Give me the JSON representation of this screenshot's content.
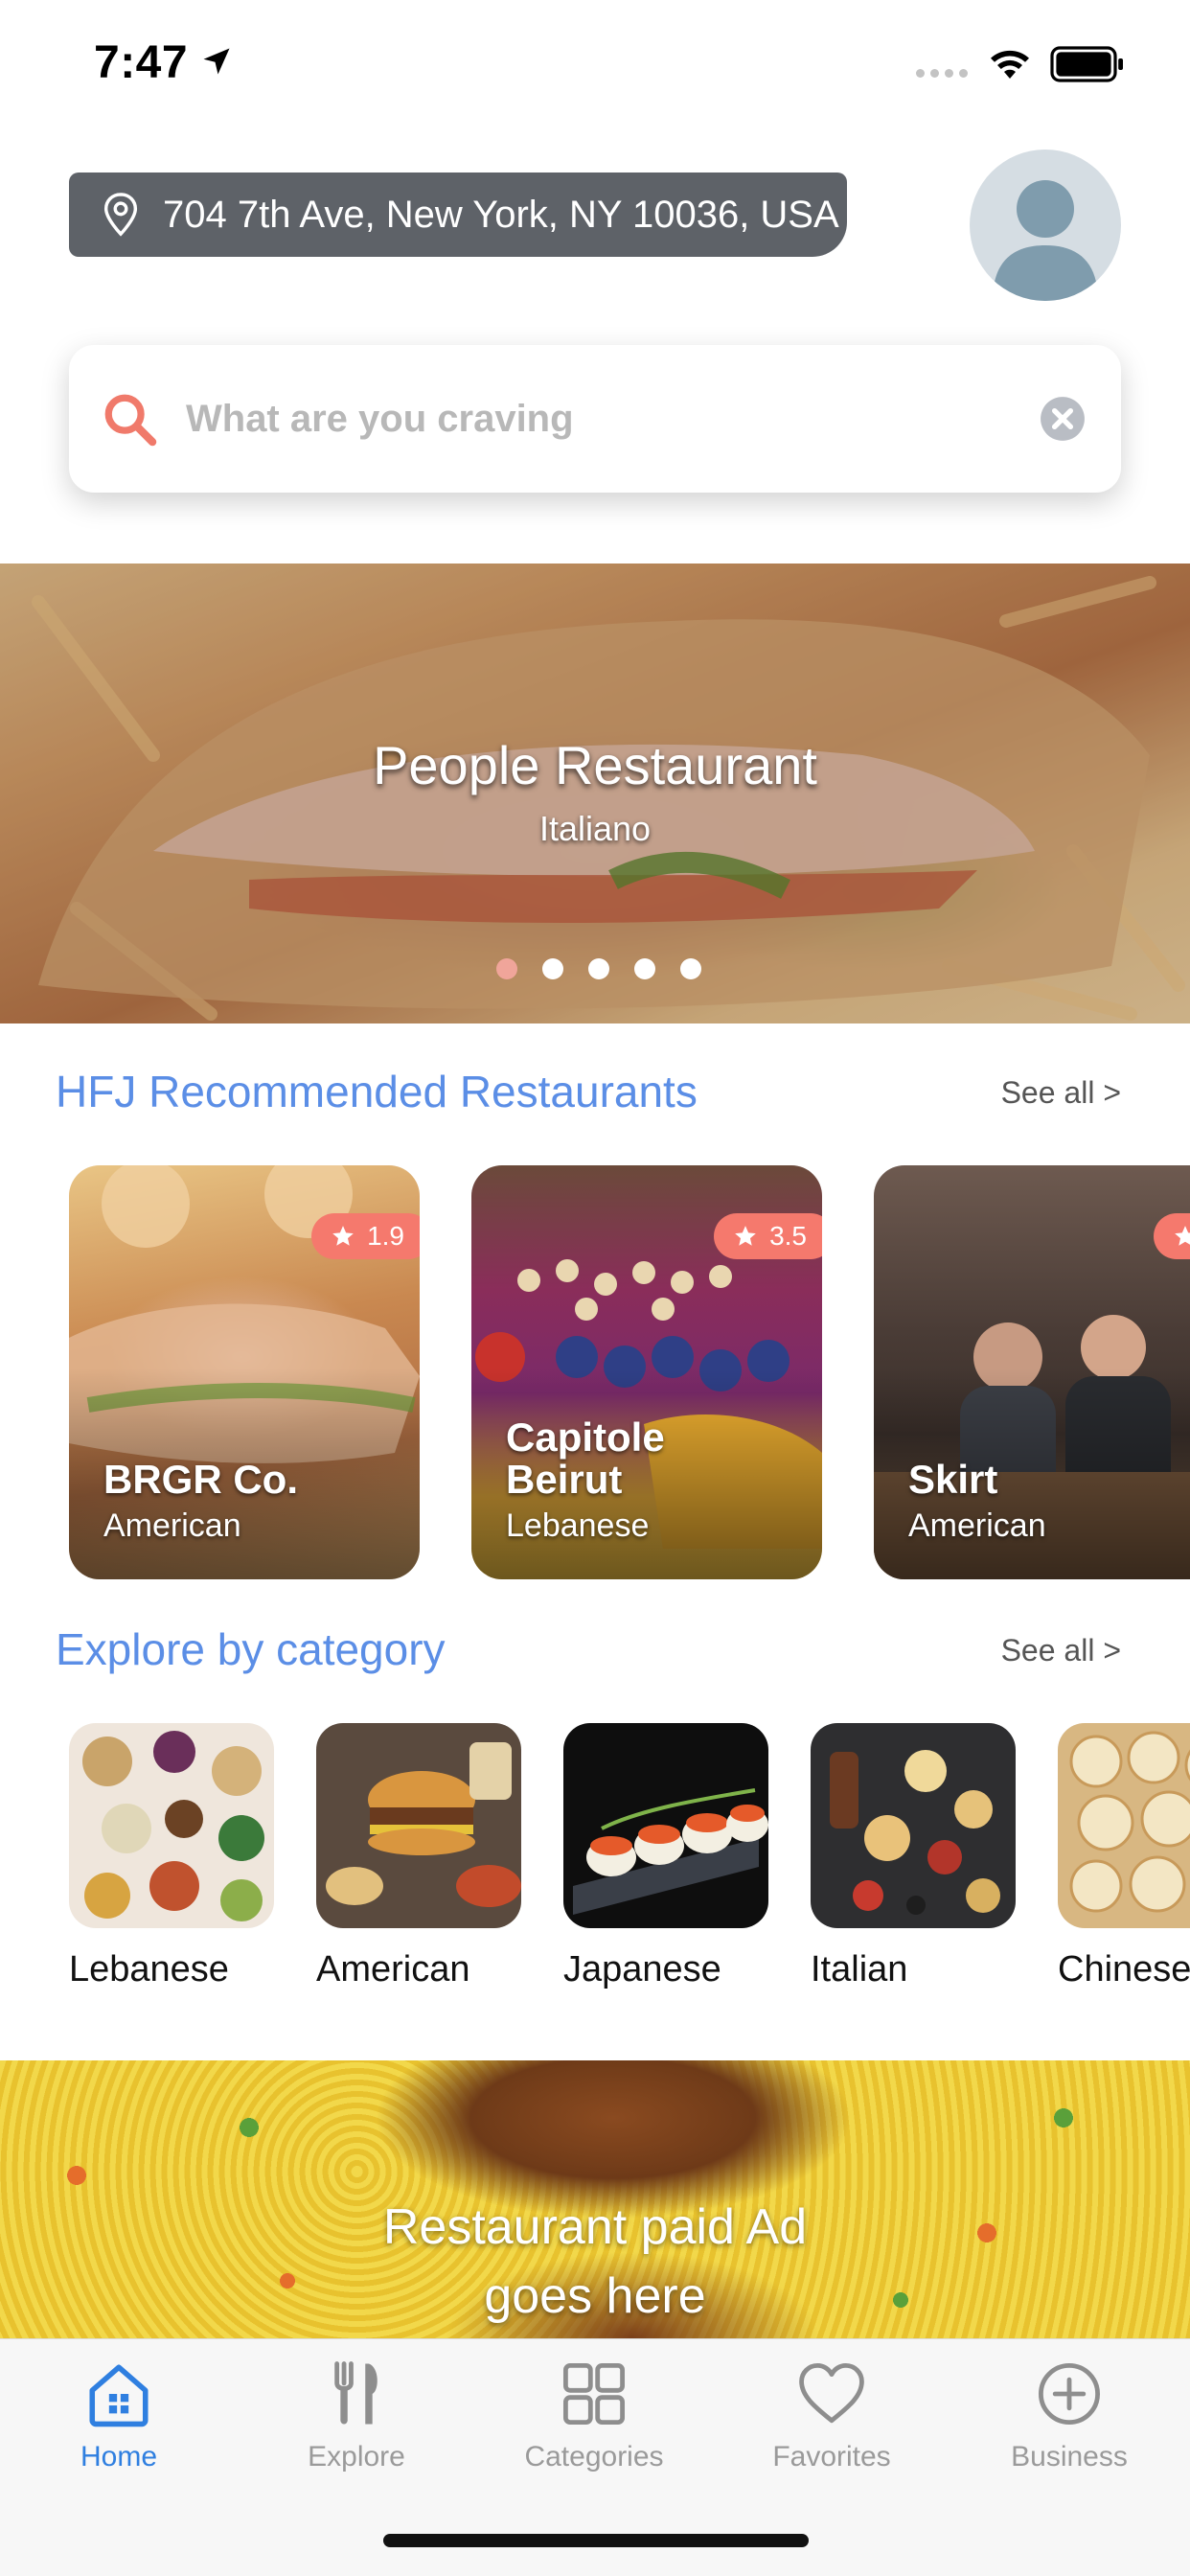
{
  "status_bar": {
    "time": "7:47"
  },
  "header": {
    "address": "704 7th Ave, New York, NY 10036, USA"
  },
  "search": {
    "placeholder": "What are you craving"
  },
  "hero": {
    "title": "People Restaurant",
    "subtitle": "Italiano",
    "slide_count": 5,
    "active_slide": 1
  },
  "recommended": {
    "title": "HFJ Recommended Restaurants",
    "see_all": "See all >",
    "items": [
      {
        "name": "BRGR Co.",
        "cuisine": "American",
        "rating": "1.9"
      },
      {
        "name": "Capitole Beirut",
        "cuisine": "Lebanese",
        "rating": "3.5"
      },
      {
        "name": "Skirt",
        "cuisine": "American",
        "rating": ""
      }
    ]
  },
  "categories": {
    "title": "Explore by category",
    "see_all": "See all >",
    "items": [
      {
        "label": "Lebanese"
      },
      {
        "label": "American"
      },
      {
        "label": "Japanese"
      },
      {
        "label": "Italian"
      },
      {
        "label": "Chinese"
      }
    ]
  },
  "ad": {
    "line1": "Restaurant paid Ad",
    "line2": "goes here"
  },
  "tab_bar": {
    "items": [
      {
        "label": "Home",
        "icon": "home-icon",
        "active": true
      },
      {
        "label": "Explore",
        "icon": "fork-knife-icon",
        "active": false
      },
      {
        "label": "Categories",
        "icon": "grid-icon",
        "active": false
      },
      {
        "label": "Favorites",
        "icon": "heart-icon",
        "active": false
      },
      {
        "label": "Business",
        "icon": "plus-circle-icon",
        "active": false
      }
    ]
  },
  "colors": {
    "accent_blue": "#5b8ee6",
    "tab_active": "#2f7fe0",
    "rating_badge": "#f5796d",
    "address_pill": "#5e6268",
    "search_icon": "#f07a6b"
  }
}
